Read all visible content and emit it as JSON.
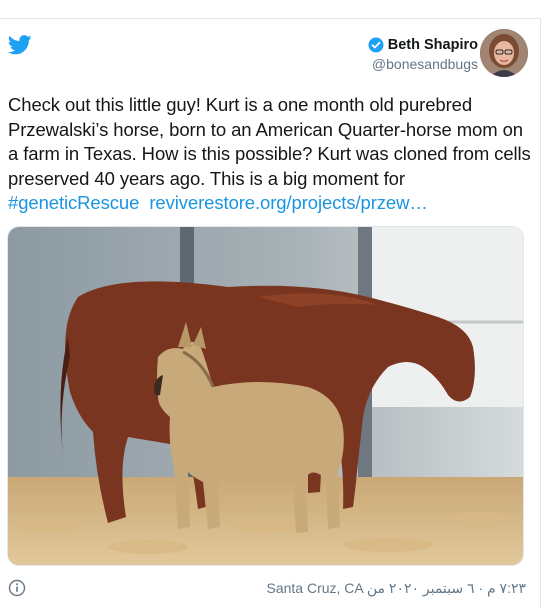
{
  "tweet": {
    "author_name": "Beth Shapiro",
    "handle": "@bonesandbugs",
    "text_parts": [
      "Check out this little guy! Kurt is a one month old purebred Przewalski’s horse, born to an American Quarter-horse mom on a farm in Texas. How is this possible? Kurt was cloned from cells preserved 40 years ago. This is a big moment for "
    ],
    "hashtag": "#geneticRescue",
    "link": "reviverestore.org/projects/przew…",
    "location": "Santa Cruz, CA",
    "timestamp": "٧:٢٣ م · ٦ سبتمبر ٢٠٢٠ من"
  },
  "colors": {
    "brand": "#1da1f2",
    "link": "#1b95e0",
    "text": "#14171a",
    "muted": "#657786"
  },
  "icons": {
    "logo": "twitter-bird-icon",
    "verified": "verified-badge-icon",
    "info": "info-icon"
  }
}
